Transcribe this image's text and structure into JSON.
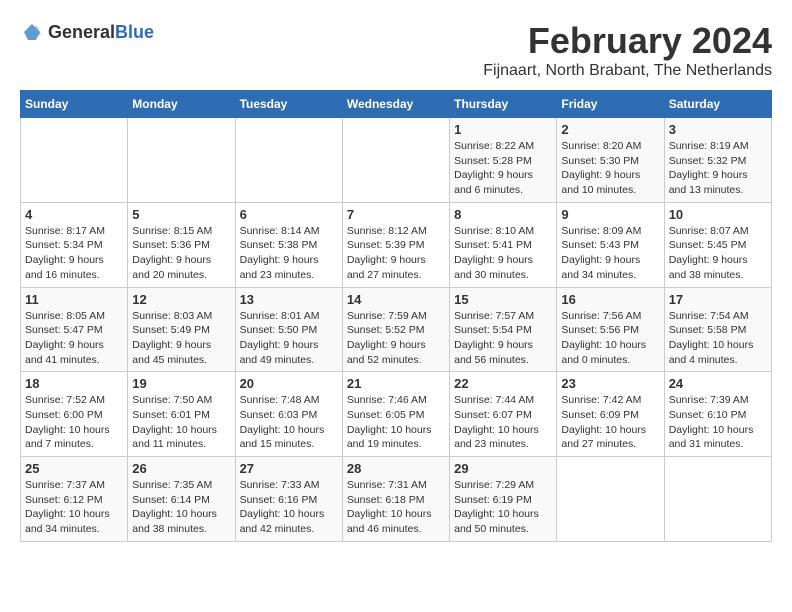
{
  "logo": {
    "general": "General",
    "blue": "Blue"
  },
  "title": "February 2024",
  "subtitle": "Fijnaart, North Brabant, The Netherlands",
  "weekdays": [
    "Sunday",
    "Monday",
    "Tuesday",
    "Wednesday",
    "Thursday",
    "Friday",
    "Saturday"
  ],
  "weeks": [
    [
      {
        "day": "",
        "info": ""
      },
      {
        "day": "",
        "info": ""
      },
      {
        "day": "",
        "info": ""
      },
      {
        "day": "",
        "info": ""
      },
      {
        "day": "1",
        "info": "Sunrise: 8:22 AM\nSunset: 5:28 PM\nDaylight: 9 hours\nand 6 minutes."
      },
      {
        "day": "2",
        "info": "Sunrise: 8:20 AM\nSunset: 5:30 PM\nDaylight: 9 hours\nand 10 minutes."
      },
      {
        "day": "3",
        "info": "Sunrise: 8:19 AM\nSunset: 5:32 PM\nDaylight: 9 hours\nand 13 minutes."
      }
    ],
    [
      {
        "day": "4",
        "info": "Sunrise: 8:17 AM\nSunset: 5:34 PM\nDaylight: 9 hours\nand 16 minutes."
      },
      {
        "day": "5",
        "info": "Sunrise: 8:15 AM\nSunset: 5:36 PM\nDaylight: 9 hours\nand 20 minutes."
      },
      {
        "day": "6",
        "info": "Sunrise: 8:14 AM\nSunset: 5:38 PM\nDaylight: 9 hours\nand 23 minutes."
      },
      {
        "day": "7",
        "info": "Sunrise: 8:12 AM\nSunset: 5:39 PM\nDaylight: 9 hours\nand 27 minutes."
      },
      {
        "day": "8",
        "info": "Sunrise: 8:10 AM\nSunset: 5:41 PM\nDaylight: 9 hours\nand 30 minutes."
      },
      {
        "day": "9",
        "info": "Sunrise: 8:09 AM\nSunset: 5:43 PM\nDaylight: 9 hours\nand 34 minutes."
      },
      {
        "day": "10",
        "info": "Sunrise: 8:07 AM\nSunset: 5:45 PM\nDaylight: 9 hours\nand 38 minutes."
      }
    ],
    [
      {
        "day": "11",
        "info": "Sunrise: 8:05 AM\nSunset: 5:47 PM\nDaylight: 9 hours\nand 41 minutes."
      },
      {
        "day": "12",
        "info": "Sunrise: 8:03 AM\nSunset: 5:49 PM\nDaylight: 9 hours\nand 45 minutes."
      },
      {
        "day": "13",
        "info": "Sunrise: 8:01 AM\nSunset: 5:50 PM\nDaylight: 9 hours\nand 49 minutes."
      },
      {
        "day": "14",
        "info": "Sunrise: 7:59 AM\nSunset: 5:52 PM\nDaylight: 9 hours\nand 52 minutes."
      },
      {
        "day": "15",
        "info": "Sunrise: 7:57 AM\nSunset: 5:54 PM\nDaylight: 9 hours\nand 56 minutes."
      },
      {
        "day": "16",
        "info": "Sunrise: 7:56 AM\nSunset: 5:56 PM\nDaylight: 10 hours\nand 0 minutes."
      },
      {
        "day": "17",
        "info": "Sunrise: 7:54 AM\nSunset: 5:58 PM\nDaylight: 10 hours\nand 4 minutes."
      }
    ],
    [
      {
        "day": "18",
        "info": "Sunrise: 7:52 AM\nSunset: 6:00 PM\nDaylight: 10 hours\nand 7 minutes."
      },
      {
        "day": "19",
        "info": "Sunrise: 7:50 AM\nSunset: 6:01 PM\nDaylight: 10 hours\nand 11 minutes."
      },
      {
        "day": "20",
        "info": "Sunrise: 7:48 AM\nSunset: 6:03 PM\nDaylight: 10 hours\nand 15 minutes."
      },
      {
        "day": "21",
        "info": "Sunrise: 7:46 AM\nSunset: 6:05 PM\nDaylight: 10 hours\nand 19 minutes."
      },
      {
        "day": "22",
        "info": "Sunrise: 7:44 AM\nSunset: 6:07 PM\nDaylight: 10 hours\nand 23 minutes."
      },
      {
        "day": "23",
        "info": "Sunrise: 7:42 AM\nSunset: 6:09 PM\nDaylight: 10 hours\nand 27 minutes."
      },
      {
        "day": "24",
        "info": "Sunrise: 7:39 AM\nSunset: 6:10 PM\nDaylight: 10 hours\nand 31 minutes."
      }
    ],
    [
      {
        "day": "25",
        "info": "Sunrise: 7:37 AM\nSunset: 6:12 PM\nDaylight: 10 hours\nand 34 minutes."
      },
      {
        "day": "26",
        "info": "Sunrise: 7:35 AM\nSunset: 6:14 PM\nDaylight: 10 hours\nand 38 minutes."
      },
      {
        "day": "27",
        "info": "Sunrise: 7:33 AM\nSunset: 6:16 PM\nDaylight: 10 hours\nand 42 minutes."
      },
      {
        "day": "28",
        "info": "Sunrise: 7:31 AM\nSunset: 6:18 PM\nDaylight: 10 hours\nand 46 minutes."
      },
      {
        "day": "29",
        "info": "Sunrise: 7:29 AM\nSunset: 6:19 PM\nDaylight: 10 hours\nand 50 minutes."
      },
      {
        "day": "",
        "info": ""
      },
      {
        "day": "",
        "info": ""
      }
    ]
  ]
}
